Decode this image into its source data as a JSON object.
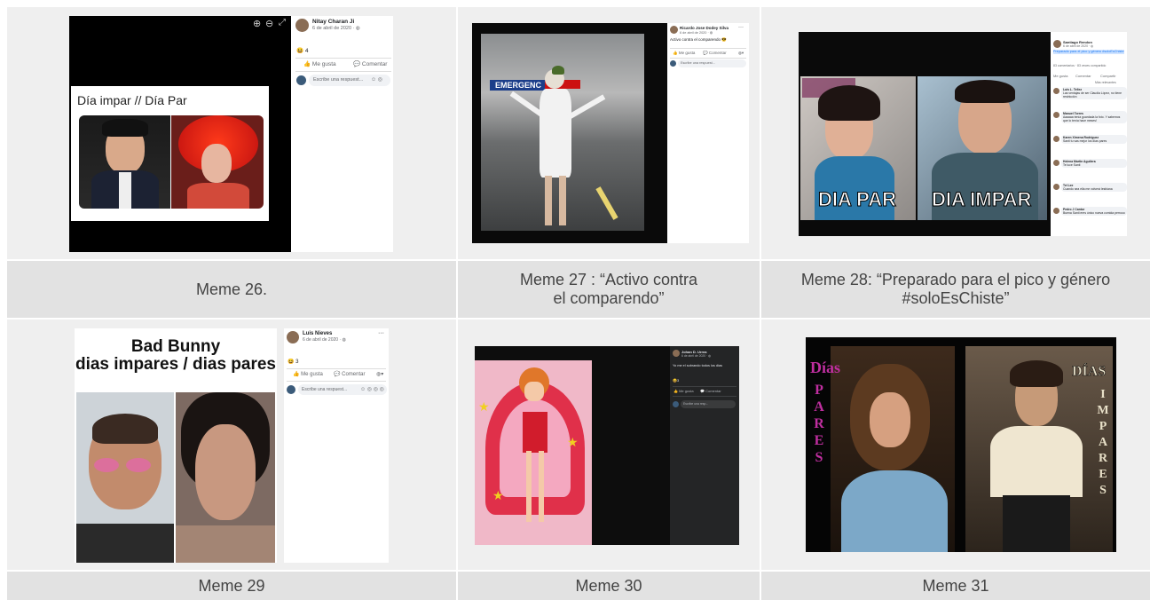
{
  "memes": [
    {
      "caption": "Meme 26.",
      "user": "Nitay Charan Ji",
      "date": "6 de abril de 2020 · ◍",
      "meme_text": "Día impar // Día Par",
      "reactions": "4",
      "like": "Me gusta",
      "comment": "Comentar",
      "write": "Escribe una respuest...",
      "icons": [
        "zoom-in-icon",
        "zoom-out-icon",
        "expand-icon"
      ]
    },
    {
      "caption": "Meme 27 : “Activo contra\nel comparendo”",
      "user": "Ricardo Jose Dodey Silva",
      "date": "6 de abril de 2020 · ◍",
      "post_text": "Activo contra el comparendo 😎",
      "sign": "EMERGENC",
      "like": "Me gusta",
      "comment": "Comentar",
      "write": "Escribe una respuest..."
    },
    {
      "caption": "Meme 28: “Preparado para el pico y género\n#soloEsChiste”",
      "user": "Santiago Rendon",
      "date": "6 de abril de 2020 · ◍",
      "post_text": "Preparado para el pico y género #soloEsChiste",
      "left_label": "DIA PAR",
      "right_label": "DIA IMPAR",
      "comments_count": "83 comentarios · 83 veces compartido",
      "like": "Me gusta",
      "comment": "Comentar",
      "share": "Compartir",
      "more": "Más relevantes",
      "comments": [
        {
          "name": "Luis L. Tellez",
          "text": "Las ventajas de ser Claudia López, no tiene restricción"
        },
        {
          "name": "Manuel Torres",
          "text": "Aaaaaa tenía guardada la foto. Y sabemos que lo tenía hace meses!"
        },
        {
          "name": "Karen Ximena Rodriguez",
          "text": "Santi tu vas mejor los días pares"
        },
        {
          "name": "Helena Martin Aguilera",
          "text": "Te luce Santi"
        },
        {
          "name": "Tel Lee",
          "text": "Cuando sea ella me volverá lesbiana"
        },
        {
          "name": "Pedro J Cantor",
          "text": "Buena Santi eres único nueva comida perrooo"
        }
      ]
    },
    {
      "caption": "Meme 29",
      "user": "Luis Nieves",
      "date": "6 de abril de 2020 · ◍",
      "meme_title_1": "Bad Bunny",
      "meme_title_2": "dias impares / dias pares",
      "reactions": "3",
      "like": "Me gusta",
      "comment": "Comentar",
      "write": "Escribe una respuest..."
    },
    {
      "caption": "Meme 30",
      "user": "Johan D. Urrea",
      "date": "6 de abril de 2020 · ◍",
      "post_text": "Yo me el sobrando todos los días",
      "reactions": "3",
      "like": "Me gusta",
      "comment": "Comentar",
      "write": "Escribe una resp..."
    },
    {
      "caption": "Meme 31",
      "left_word": "Días",
      "left_letters": [
        "P",
        "A",
        "R",
        "E",
        "S"
      ],
      "right_word": "DÍAS",
      "right_letters": [
        "I",
        "M",
        "P",
        "A",
        "R",
        "E",
        "S"
      ]
    }
  ],
  "colors": {
    "cell_bg": "#efefef",
    "caption_bg": "#e2e2e2",
    "caption_text": "#444444",
    "fb_blue": "#385898",
    "text_pink": "#c02fa0"
  }
}
